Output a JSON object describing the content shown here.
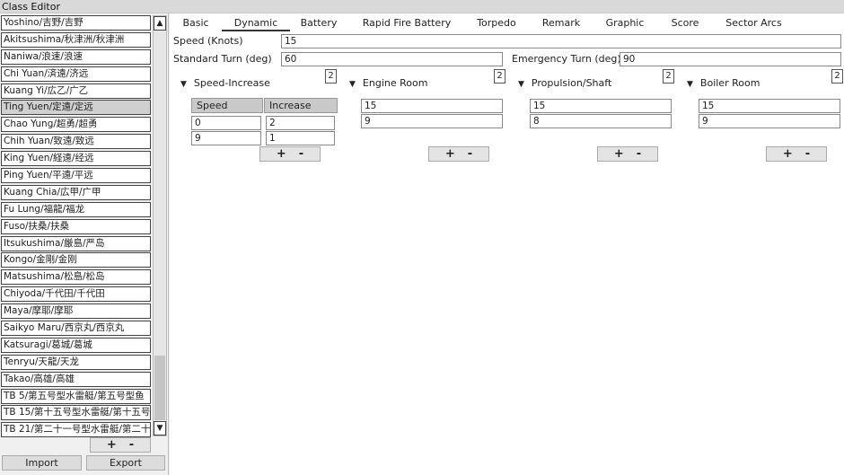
{
  "window": {
    "title": "Class Editor"
  },
  "ships": [
    "Yoshino/吉野/吉野",
    "Akitsushima/秋津洲/秋津洲",
    "Naniwa/浪速/浪速",
    "Chi Yuan/済遠/济远",
    "Kuang Yi/広乙/广乙",
    "Ting Yuen/定遠/定远",
    "Chao Yung/超勇/超勇",
    "Chih Yuan/致遠/致远",
    "King Yuen/経遠/经远",
    "Ping Yuen/平遠/平远",
    "Kuang Chia/広甲/广甲",
    "Fu Lung/福龍/福龙",
    "Fuso/扶桑/扶桑",
    "Itsukushima/厳島/严岛",
    "Kongo/金剛/金刚",
    "Matsushima/松島/松岛",
    "Chiyoda/千代田/千代田",
    "Maya/摩耶/摩耶",
    "Saikyo Maru/西京丸/西京丸",
    "Katsuragi/葛城/葛城",
    "Tenryu/天龍/天龙",
    "Takao/高雄/高雄",
    "TB 5/第五号型水雷艇/第五号型鱼",
    "TB 15/第十五号型水雷艇/第十五号",
    "TB 21/第二十一号型水雷艇/第二十"
  ],
  "selected_index": 5,
  "list_controls": {
    "plus": "+",
    "minus": "-",
    "scroll_up": "▲",
    "scroll_down": "▼"
  },
  "footer": {
    "import_label": "Import",
    "export_label": "Export"
  },
  "tabs": [
    "Basic",
    "Dynamic",
    "Battery",
    "Rapid Fire Battery",
    "Torpedo",
    "Remark",
    "Graphic",
    "Score",
    "Sector Arcs"
  ],
  "active_tab": 1,
  "fields": {
    "speed_label": "Speed (Knots)",
    "speed_value": "15",
    "std_turn_label": "Standard Turn (deg)",
    "std_turn_value": "60",
    "emer_turn_label": "Emergency Turn (deg)",
    "emer_turn_value": "90"
  },
  "sections": {
    "speed_increase": {
      "title": "Speed-Increase",
      "count": "2",
      "headers": [
        "Speed",
        "Increase"
      ],
      "rows": [
        [
          "0",
          "2"
        ],
        [
          "9",
          "1"
        ]
      ]
    },
    "engine_room": {
      "title": "Engine Room",
      "count": "2",
      "values": [
        "15",
        "9"
      ]
    },
    "propulsion": {
      "title": "Propulsion/Shaft",
      "count": "2",
      "values": [
        "15",
        "8"
      ]
    },
    "boiler_room": {
      "title": "Boiler Room",
      "count": "2",
      "values": [
        "15",
        "9"
      ]
    }
  },
  "collapse_glyph": "▼",
  "pm": {
    "plus": "+",
    "minus": "-"
  }
}
